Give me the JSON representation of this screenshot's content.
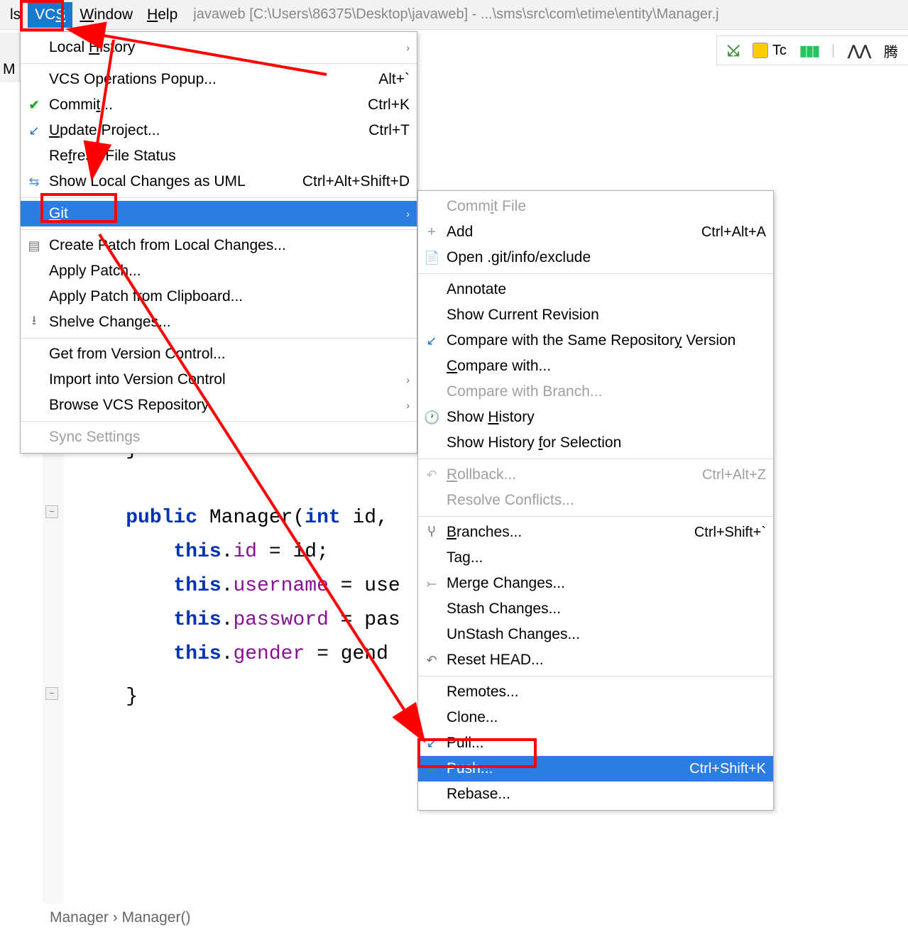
{
  "menubar": {
    "items": [
      "ls",
      "VCS",
      "Window",
      "Help"
    ],
    "window_title": "javaweb [C:\\Users\\86375\\Desktop\\javaweb] - ...\\sms\\src\\com\\etime\\entity\\Manager.j"
  },
  "toolbar": {
    "tc_label": "Tc",
    "chn_label": "腾"
  },
  "partial_label": "M",
  "vcs_menu": {
    "local_history": "Local History",
    "vcs_ops": "VCS Operations Popup...",
    "vcs_ops_sc": "Alt+`",
    "commit": "Commit...",
    "commit_sc": "Ctrl+K",
    "update": "Update Project...",
    "update_sc": "Ctrl+T",
    "refresh": "Refresh File Status",
    "show_uml": "Show Local Changes as UML",
    "show_uml_sc": "Ctrl+Alt+Shift+D",
    "git": "Git",
    "create_patch": "Create Patch from Local Changes...",
    "apply_patch": "Apply Patch...",
    "apply_clip": "Apply Patch from Clipboard...",
    "shelve": "Shelve Changes...",
    "get_vc": "Get from Version Control...",
    "import_vc": "Import into Version Control",
    "browse_vcs": "Browse VCS Repository",
    "sync": "Sync Settings"
  },
  "git_menu": {
    "commit_file": "Commit File",
    "add": "Add",
    "add_sc": "Ctrl+Alt+A",
    "open_exclude": "Open .git/info/exclude",
    "annotate": "Annotate",
    "show_current": "Show Current Revision",
    "compare_same": "Compare with the Same Repository Version",
    "compare_with": "Compare with...",
    "compare_branch": "Compare with Branch...",
    "show_history": "Show History",
    "show_history_sel": "Show History for Selection",
    "rollback": "Rollback...",
    "rollback_sc": "Ctrl+Alt+Z",
    "resolve": "Resolve Conflicts...",
    "branches": "Branches...",
    "branches_sc": "Ctrl+Shift+`",
    "tag": "Tag...",
    "merge": "Merge Changes...",
    "stash": "Stash Changes...",
    "unstash": "UnStash Changes...",
    "reset": "Reset HEAD...",
    "remotes": "Remotes...",
    "clone": "Clone...",
    "pull": "Pull...",
    "push": "Push...",
    "push_sc": "Ctrl+Shift+K",
    "rebase": "Rebase..."
  },
  "code": {
    "line1": "    }",
    "line2_pre": "    ",
    "line2_kw1": "public",
    "line2_fn": " Manager",
    "line2_paren": "(",
    "line2_kw2": "int",
    "line2_rest": " id, ",
    "line3_pre": "        ",
    "line3_kw": "this",
    "line3_dot": ".",
    "line3_fld": "id",
    "line3_rest": " = id;",
    "line4_fld": "username",
    "line4_rest": " = use",
    "line5_fld": "password",
    "line5_rest": " = pas",
    "line6_fld": "gender",
    "line6_rest": " = gend",
    "line7": "    }"
  },
  "breadcrumb": {
    "a": "Manager",
    "b": "Manager()"
  }
}
